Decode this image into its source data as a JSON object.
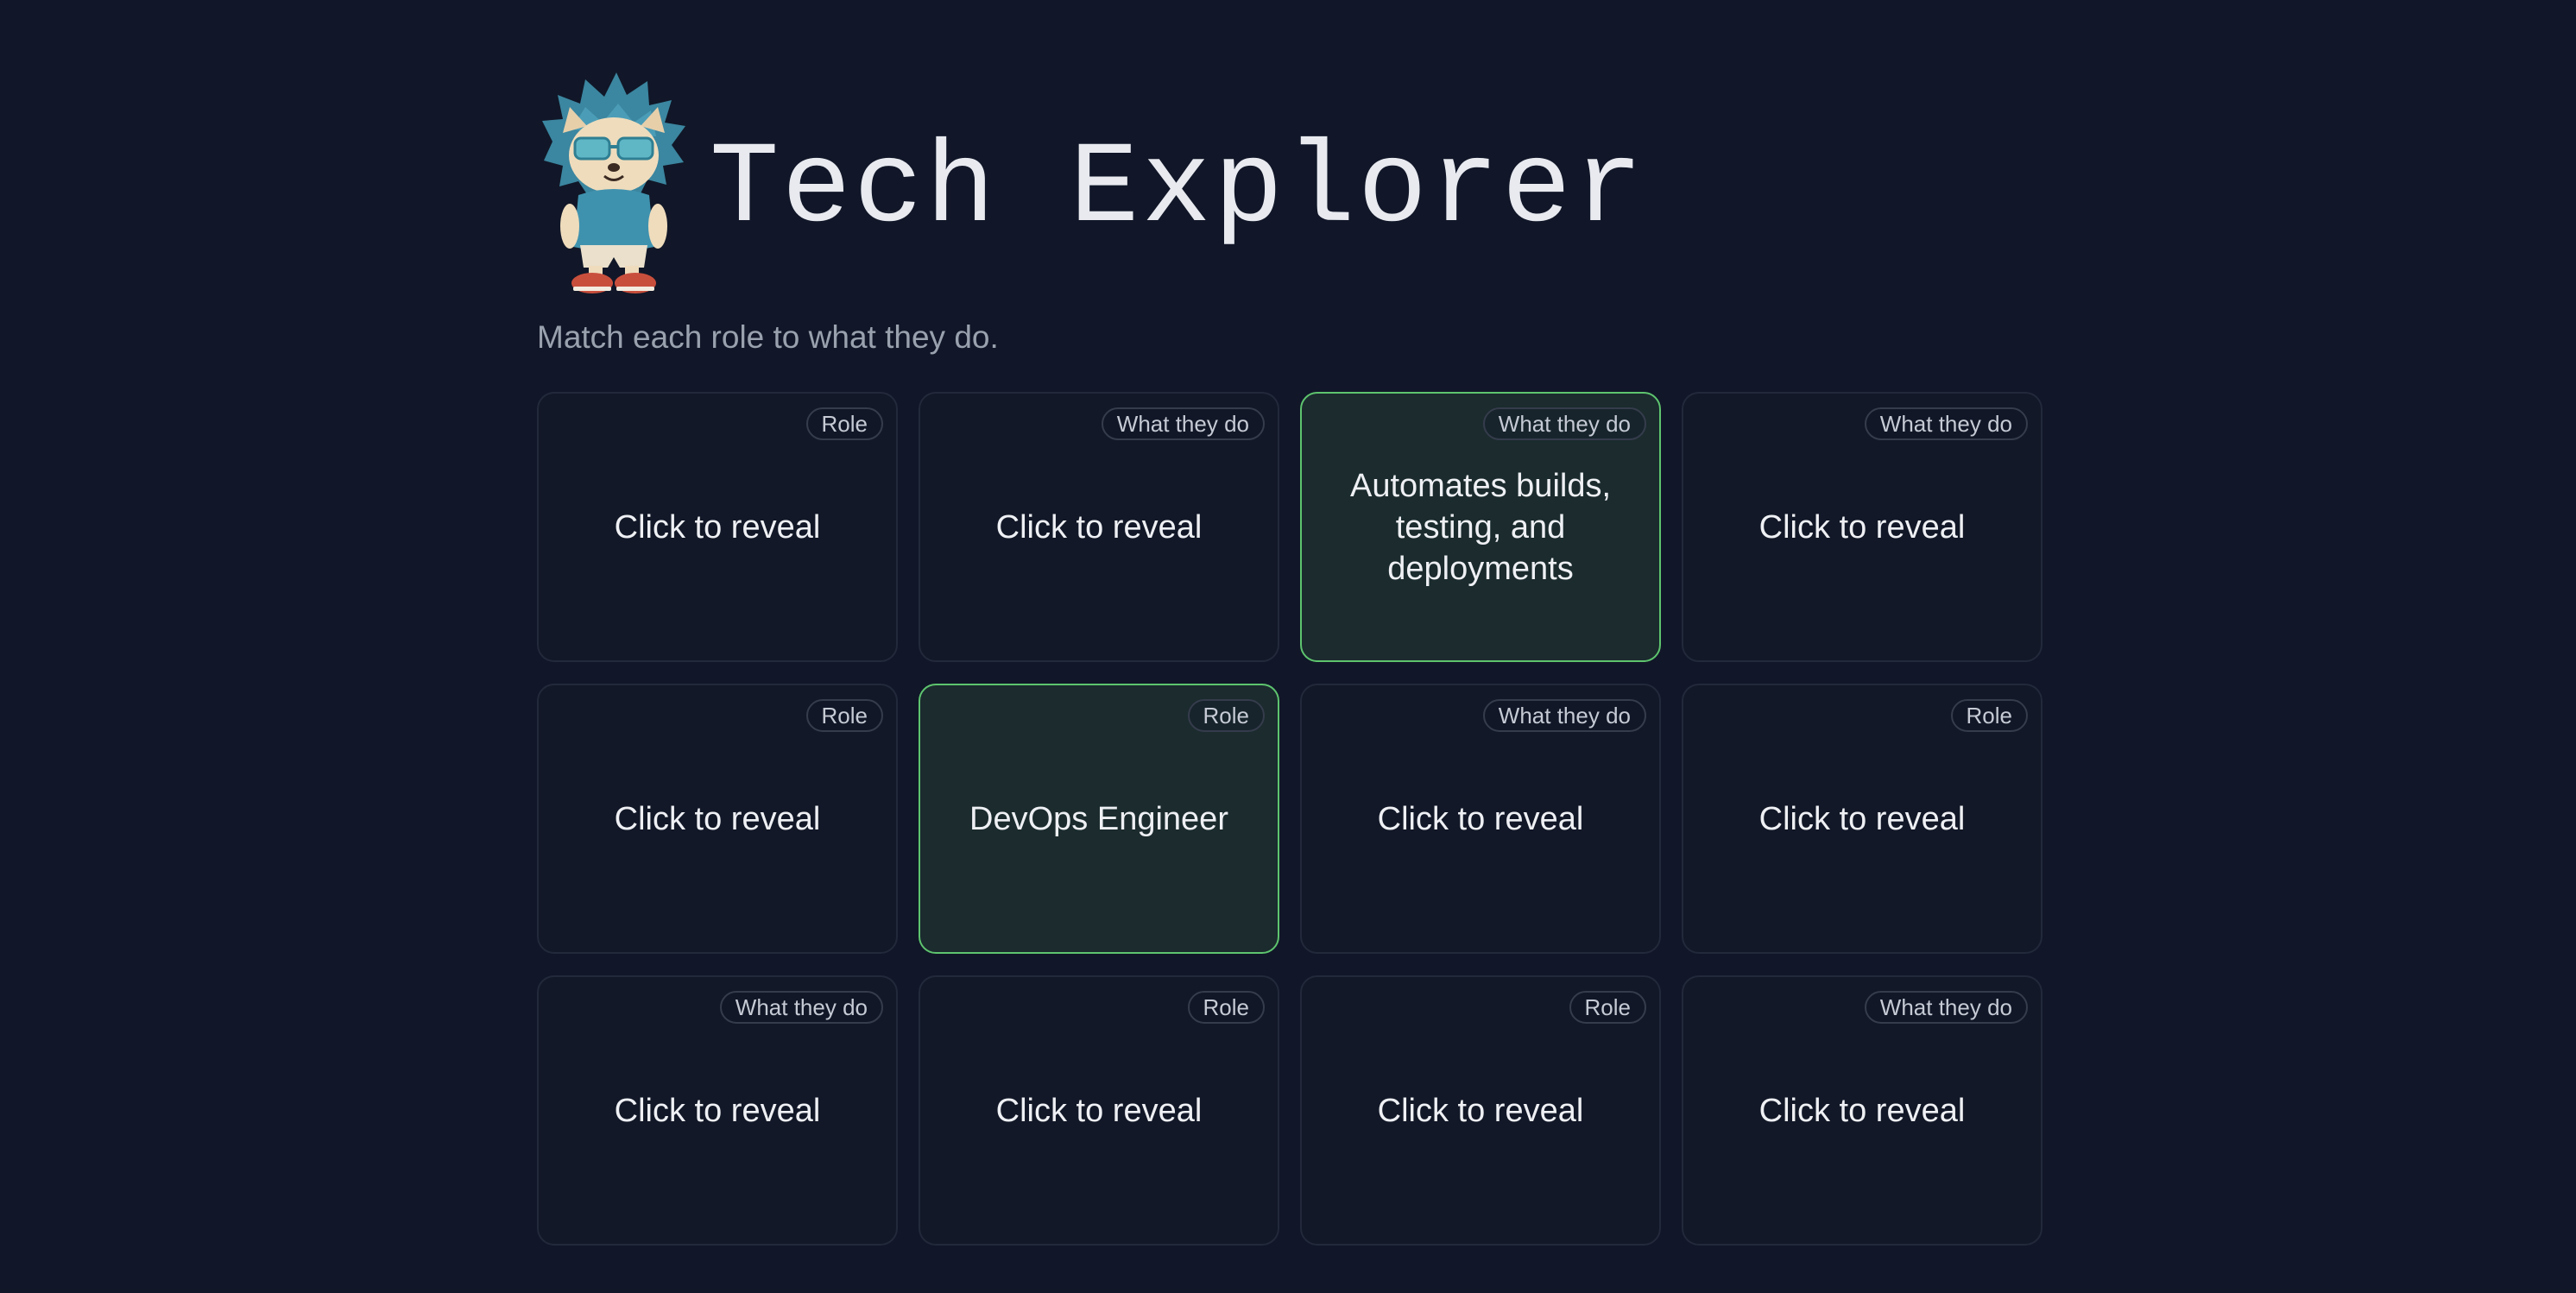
{
  "header": {
    "title": "Tech Explorer",
    "mascot_icon": "hedgehog-mascot-icon"
  },
  "subtitle": "Match each role to what they do.",
  "colors": {
    "background": "#111728",
    "card": "#121827",
    "revealed_card": "#1b2b2e",
    "revealed_border": "#5ec46e"
  },
  "cards": [
    {
      "badge": "Role",
      "text": "Click to reveal",
      "revealed": false
    },
    {
      "badge": "What they do",
      "text": "Click to reveal",
      "revealed": false
    },
    {
      "badge": "What they do",
      "text": "Automates builds, testing, and deployments",
      "revealed": true
    },
    {
      "badge": "What they do",
      "text": "Click to reveal",
      "revealed": false
    },
    {
      "badge": "Role",
      "text": "Click to reveal",
      "revealed": false
    },
    {
      "badge": "Role",
      "text": "DevOps Engineer",
      "revealed": true
    },
    {
      "badge": "What they do",
      "text": "Click to reveal",
      "revealed": false
    },
    {
      "badge": "Role",
      "text": "Click to reveal",
      "revealed": false
    },
    {
      "badge": "What they do",
      "text": "Click to reveal",
      "revealed": false
    },
    {
      "badge": "Role",
      "text": "Click to reveal",
      "revealed": false
    },
    {
      "badge": "Role",
      "text": "Click to reveal",
      "revealed": false
    },
    {
      "badge": "What they do",
      "text": "Click to reveal",
      "revealed": false
    }
  ]
}
